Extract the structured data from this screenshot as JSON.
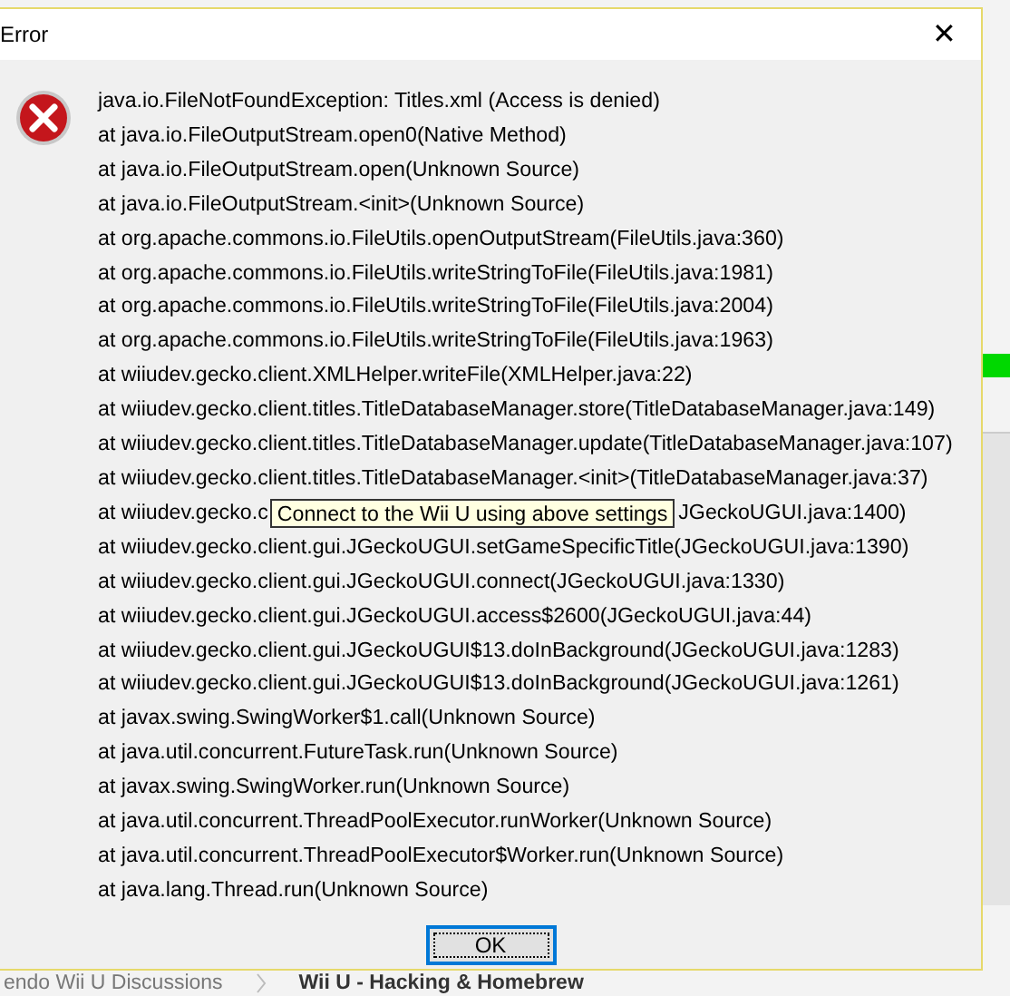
{
  "dialog": {
    "title": "Error",
    "close_symbol": "✕",
    "lines": [
      {
        "kind": "text",
        "text": "java.io.FileNotFoundException: Titles.xml (Access is denied)"
      },
      {
        "kind": "text",
        "text": "at java.io.FileOutputStream.open0(Native Method)"
      },
      {
        "kind": "text",
        "text": "at java.io.FileOutputStream.open(Unknown Source)"
      },
      {
        "kind": "text",
        "text": "at java.io.FileOutputStream.<init>(Unknown Source)"
      },
      {
        "kind": "text",
        "text": "at org.apache.commons.io.FileUtils.openOutputStream(FileUtils.java:360)"
      },
      {
        "kind": "text",
        "text": "at org.apache.commons.io.FileUtils.writeStringToFile(FileUtils.java:1981)"
      },
      {
        "kind": "text",
        "text": "at org.apache.commons.io.FileUtils.writeStringToFile(FileUtils.java:2004)"
      },
      {
        "kind": "text",
        "text": "at org.apache.commons.io.FileUtils.writeStringToFile(FileUtils.java:1963)"
      },
      {
        "kind": "text",
        "text": "at wiiudev.gecko.client.XMLHelper.writeFile(XMLHelper.java:22)"
      },
      {
        "kind": "text",
        "text": "at wiiudev.gecko.client.titles.TitleDatabaseManager.store(TitleDatabaseManager.java:149)"
      },
      {
        "kind": "text",
        "text": "at wiiudev.gecko.client.titles.TitleDatabaseManager.update(TitleDatabaseManager.java:107)"
      },
      {
        "kind": "text",
        "text": "at wiiudev.gecko.client.titles.TitleDatabaseManager.<init>(TitleDatabaseManager.java:37)"
      },
      {
        "kind": "covered",
        "before": "at wiiudev.gecko.c",
        "after": "JGeckoUGUI.java:1400)",
        "tooltip": "Connect to the Wii U using above settings"
      },
      {
        "kind": "text",
        "text": "at wiiudev.gecko.client.gui.JGeckoUGUI.setGameSpecificTitle(JGeckoUGUI.java:1390)"
      },
      {
        "kind": "text",
        "text": "at wiiudev.gecko.client.gui.JGeckoUGUI.connect(JGeckoUGUI.java:1330)"
      },
      {
        "kind": "text",
        "text": "at wiiudev.gecko.client.gui.JGeckoUGUI.access$2600(JGeckoUGUI.java:44)"
      },
      {
        "kind": "text",
        "text": "at wiiudev.gecko.client.gui.JGeckoUGUI$13.doInBackground(JGeckoUGUI.java:1283)"
      },
      {
        "kind": "text",
        "text": "at wiiudev.gecko.client.gui.JGeckoUGUI$13.doInBackground(JGeckoUGUI.java:1261)"
      },
      {
        "kind": "text",
        "text": "at javax.swing.SwingWorker$1.call(Unknown Source)"
      },
      {
        "kind": "text",
        "text": "at java.util.concurrent.FutureTask.run(Unknown Source)"
      },
      {
        "kind": "text",
        "text": "at javax.swing.SwingWorker.run(Unknown Source)"
      },
      {
        "kind": "text",
        "text": "at java.util.concurrent.ThreadPoolExecutor.runWorker(Unknown Source)"
      },
      {
        "kind": "text",
        "text": "at java.util.concurrent.ThreadPoolExecutor$Worker.run(Unknown Source)"
      },
      {
        "kind": "text",
        "text": "at java.lang.Thread.run(Unknown Source)"
      }
    ],
    "button": "OK"
  },
  "breadcrumb": [
    {
      "label": "endo Wii U Discussions",
      "current": false
    },
    {
      "label": "Wii U - Hacking & Homebrew",
      "current": true
    }
  ]
}
